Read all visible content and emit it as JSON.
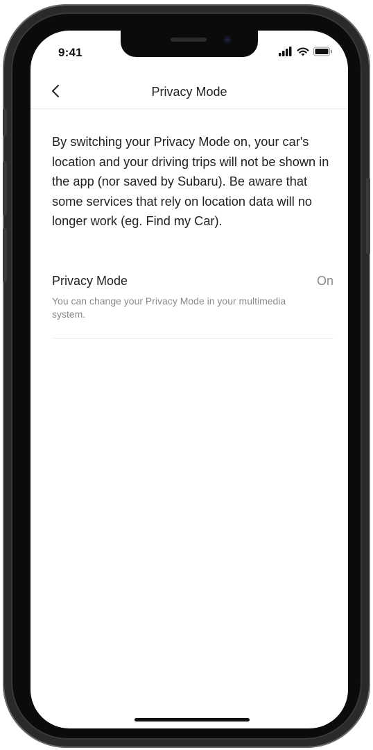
{
  "status_bar": {
    "time": "9:41",
    "icons": [
      "cellular-signal-icon",
      "wifi-icon",
      "battery-icon"
    ]
  },
  "header": {
    "back_icon": "chevron-left-icon",
    "title": "Privacy Mode"
  },
  "description": "By switching your Privacy Mode on, your car's location and your driving trips will not be shown in the app (nor saved by Subaru). Be aware that some services that rely on location data will no longer work (eg. Find my Car).",
  "setting": {
    "label": "Privacy Mode",
    "value": "On",
    "hint": "You can change your Privacy Mode in your multimedia system."
  }
}
